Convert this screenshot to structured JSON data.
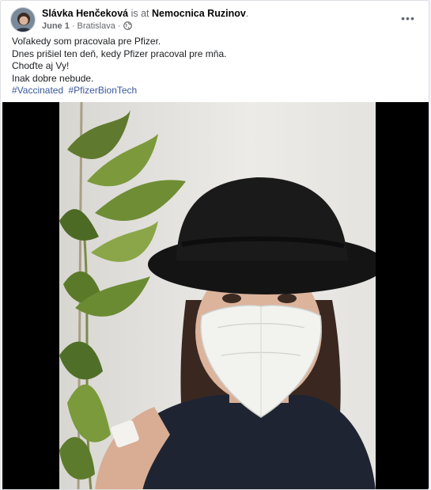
{
  "post": {
    "author": "Slávka Henčeková",
    "is_at": "is at",
    "place": "Nemocnica Ruzinov",
    "period": ".",
    "date": "June 1",
    "separator": "·",
    "location": "Bratislava",
    "more_label": "•••",
    "lines": [
      "Voľakedy som pracovala pre Pfizer.",
      "Dnes prišiel ten deň, kedy Pfizer pracoval pre mňa.",
      "Choďte aj Vy!",
      "Inak dobre nebude."
    ],
    "hashtags": [
      "#Vaccinated",
      "#PfizerBionTech"
    ]
  },
  "icons": {
    "globe": "globe-icon",
    "more": "more-options-icon"
  },
  "colors": {
    "link": "#385898",
    "secondary_text": "#65676b",
    "primary_text": "#1c1e21",
    "photo_background": "#000000"
  }
}
